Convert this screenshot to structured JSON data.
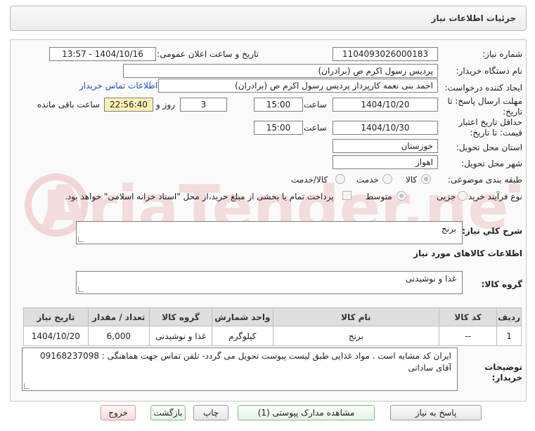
{
  "header": {
    "title": "جزئیات اطلاعات نیاز"
  },
  "form": {
    "need_number_label": "شماره نیاز:",
    "need_number": "1104093026000183",
    "announce_datetime_label": "تاریخ و ساعت اعلان عمومی:",
    "announce_datetime": "1404/10/16 - 13:57",
    "buyer_org_label": "نام دستگاه خریدار:",
    "buyer_org": "پردیس رسول اکرم ص (برادران)",
    "requester_label": "ایجاد کننده درخواست:",
    "requester": "احمد بنی نعمه کارپرداز پردیس رسول اکرم ص (برادران)",
    "buyer_contact_link": "اطلاعات تماس خریدار",
    "reply_deadline_label_1": "مهلت ارسال پاسخ: تا",
    "reply_deadline_label_2": "تاریخ:",
    "reply_date": "1404/10/20",
    "time_label": "ساعت",
    "reply_time": "15:00",
    "days_value": "3",
    "days_label": "روز و",
    "remaining_time": "22:56:40",
    "remaining_label": "ساعت باقی مانده",
    "price_validity_label_1": "حداقل تاریخ اعتبار",
    "price_validity_label_2": "قیمت: تا تاریخ:",
    "price_validity_date": "1404/10/30",
    "price_validity_time": "15:00",
    "province_label": "استان محل تحویل:",
    "province": "خوزستان",
    "city_label": "شهر محل تحویل:",
    "city": "اهواز",
    "category_label": "طبقه بندی موضوعی:",
    "category_options": [
      "کالا",
      "خدمت",
      "کالا/خدمت"
    ],
    "process_label": "نوع فرآیند خرید :",
    "process_options": [
      "جزیی",
      "متوسط"
    ],
    "treasury_note": "پرداخت تمام یا بخشی از مبلغ خرید،از محل \"اسناد خزانه اسلامی\" خواهد بود.",
    "summary_label": "شرح کلي نياز:",
    "summary": "برنج",
    "goods_info_heading": "اطلاعات کالاهای مورد نیاز",
    "goods_group_label": "گروه کالا:",
    "goods_group": "غذا و نوشیدنی",
    "buyer_notes_label_1": "توضیحات",
    "buyer_notes_label_2": "خریدار:",
    "buyer_notes": "ایران کد مشابه است . مواد غذایی طبق لیست پیوست تحویل می گردد- تلفن تماس جهت هماهنگی  :  09168237098  آقای ساداتی"
  },
  "items_table": {
    "headers": [
      "ردیف",
      "کد کالا",
      "نام کالا",
      "واحد شمارش",
      "گروه کالا",
      "تعداد / مقدار",
      "تاریخ نیاز"
    ],
    "rows": [
      [
        "1",
        "--",
        "برنج",
        "کیلوگرم",
        "غذا و نوشیدنی",
        "6,000",
        "1404/10/20"
      ]
    ]
  },
  "buttons": {
    "reply": "پاسخ به نیاز",
    "view_docs": "مشاهده مدارک پیوستی (1)",
    "print": "چاپ",
    "back": "بازگشت",
    "exit": "خروج"
  },
  "colors": {
    "highlight_yellow": "#fbf1b6",
    "link_blue": "#1a4fc5",
    "watermark": "#f1d6d6"
  },
  "watermark_text": "AriaTender.neT"
}
